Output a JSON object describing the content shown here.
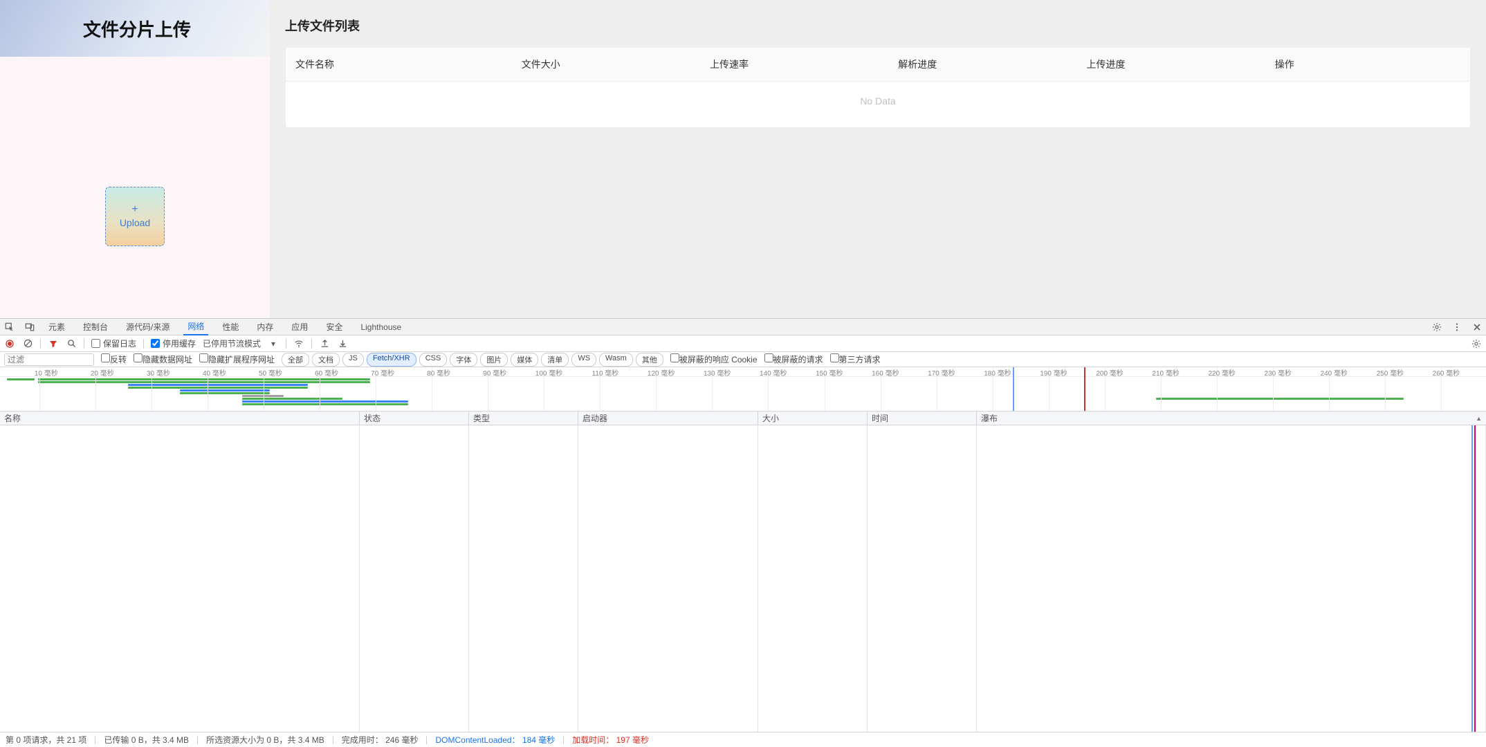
{
  "app": {
    "title": "文件分片上传",
    "upload": {
      "plus": "+",
      "label": "Upload"
    },
    "list_heading": "上传文件列表",
    "columns": {
      "name": "文件名称",
      "size": "文件大小",
      "speed": "上传速率",
      "parse": "解析进度",
      "progress": "上传进度",
      "ops": "操作"
    },
    "empty": "No Data"
  },
  "devtools": {
    "tabs": {
      "elements": "元素",
      "console": "控制台",
      "sources": "源代码/来源",
      "network": "网络",
      "performance": "性能",
      "memory": "内存",
      "application": "应用",
      "security": "安全",
      "lighthouse": "Lighthouse"
    },
    "toolbar": {
      "preserve_log": "保留日志",
      "disable_cache": "停用缓存",
      "throttling": "已停用节流模式"
    },
    "filter": {
      "placeholder": "过滤",
      "invert": "反转",
      "hide_data": "隐藏数据网址",
      "hide_ext": "隐藏扩展程序网址",
      "chips": {
        "all": "全部",
        "doc": "文档",
        "js": "JS",
        "fetch": "Fetch/XHR",
        "css": "CSS",
        "font": "字体",
        "img": "图片",
        "media": "媒体",
        "manifest": "清单",
        "ws": "WS",
        "wasm": "Wasm",
        "other": "其他"
      },
      "blocked_cookies": "被屏蔽的响应 Cookie",
      "blocked_req": "被屏蔽的请求",
      "third_party": "第三方请求"
    },
    "timeline_ticks": [
      "10 毫秒",
      "20 毫秒",
      "30 毫秒",
      "40 毫秒",
      "50 毫秒",
      "60 毫秒",
      "70 毫秒",
      "80 毫秒",
      "90 毫秒",
      "100 毫秒",
      "110 毫秒",
      "120 毫秒",
      "130 毫秒",
      "140 毫秒",
      "150 毫秒",
      "160 毫秒",
      "170 毫秒",
      "180 毫秒",
      "190 毫秒",
      "200 毫秒",
      "210 毫秒",
      "220 毫秒",
      "230 毫秒",
      "240 毫秒",
      "250 毫秒",
      "260 毫秒"
    ],
    "table_cols": {
      "name": "名称",
      "status": "状态",
      "type": "类型",
      "initiator": "启动器",
      "size": "大小",
      "time": "时间",
      "waterfall": "瀑布"
    },
    "status": {
      "requests": "第 0 项请求，共 21 项",
      "transferred": "已传输 0 B，共 3.4 MB",
      "resources": "所选资源大小为 0 B，共 3.4 MB",
      "finish_label": "完成用时：",
      "finish_value": "246 毫秒",
      "dcl_label": "DOMContentLoaded：",
      "dcl_value": "184 毫秒",
      "load_label": "加载时间：",
      "load_value": "197 毫秒"
    }
  }
}
